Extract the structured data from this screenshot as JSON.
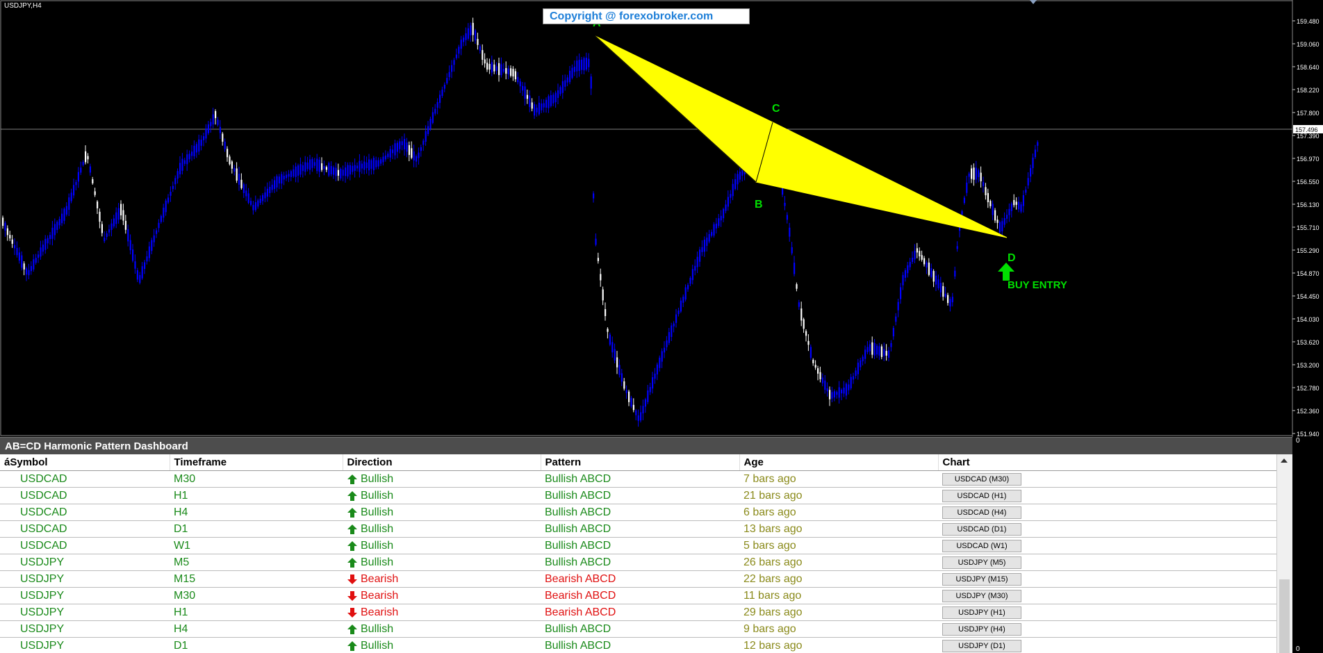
{
  "chart": {
    "symbol_tf": "USDJPY,H4",
    "copyright": "Copyright @ forexobroker.com",
    "current_price": "157.496",
    "price_levels": [
      "159.480",
      "159.060",
      "158.640",
      "158.220",
      "157.800",
      "157.390",
      "156.970",
      "156.550",
      "156.130",
      "155.710",
      "155.290",
      "154.870",
      "154.450",
      "154.030",
      "153.620",
      "153.200",
      "152.780",
      "152.360",
      "151.940"
    ],
    "points": {
      "A": "A",
      "B": "B",
      "C": "C",
      "D": "D"
    },
    "entry_label": "BUY ENTRY",
    "colors": {
      "bull": "#0000ff",
      "bear": "#ffffff",
      "pattern": "#ffff00",
      "label": "#00e000",
      "bg": "#000000"
    }
  },
  "indicator": {
    "zero_top": "0",
    "zero_bottom": "0"
  },
  "dashboard": {
    "title": "AB=CD Harmonic Pattern Dashboard",
    "columns": [
      "áSymbol",
      "Timeframe",
      "Direction",
      "Pattern",
      "Age",
      "Chart"
    ],
    "rows": [
      {
        "symbol": "USDCAD",
        "tf": "M30",
        "dir": "Bullish",
        "pattern": "Bullish ABCD",
        "age": "7 bars ago",
        "chart": "USDCAD (M30)"
      },
      {
        "symbol": "USDCAD",
        "tf": "H1",
        "dir": "Bullish",
        "pattern": "Bullish ABCD",
        "age": "21 bars ago",
        "chart": "USDCAD (H1)"
      },
      {
        "symbol": "USDCAD",
        "tf": "H4",
        "dir": "Bullish",
        "pattern": "Bullish ABCD",
        "age": "6 bars ago",
        "chart": "USDCAD (H4)"
      },
      {
        "symbol": "USDCAD",
        "tf": "D1",
        "dir": "Bullish",
        "pattern": "Bullish ABCD",
        "age": "13 bars ago",
        "chart": "USDCAD (D1)"
      },
      {
        "symbol": "USDCAD",
        "tf": "W1",
        "dir": "Bullish",
        "pattern": "Bullish ABCD",
        "age": "5 bars ago",
        "chart": "USDCAD (W1)"
      },
      {
        "symbol": "USDJPY",
        "tf": "M5",
        "dir": "Bullish",
        "pattern": "Bullish ABCD",
        "age": "26 bars ago",
        "chart": "USDJPY (M5)"
      },
      {
        "symbol": "USDJPY",
        "tf": "M15",
        "dir": "Bearish",
        "pattern": "Bearish ABCD",
        "age": "22 bars ago",
        "chart": "USDJPY (M15)"
      },
      {
        "symbol": "USDJPY",
        "tf": "M30",
        "dir": "Bearish",
        "pattern": "Bearish ABCD",
        "age": "11 bars ago",
        "chart": "USDJPY (M30)"
      },
      {
        "symbol": "USDJPY",
        "tf": "H1",
        "dir": "Bearish",
        "pattern": "Bearish ABCD",
        "age": "29 bars ago",
        "chart": "USDJPY (H1)"
      },
      {
        "symbol": "USDJPY",
        "tf": "H4",
        "dir": "Bullish",
        "pattern": "Bullish ABCD",
        "age": "9 bars ago",
        "chart": "USDJPY (H4)"
      },
      {
        "symbol": "USDJPY",
        "tf": "D1",
        "dir": "Bullish",
        "pattern": "Bullish ABCD",
        "age": "12 bars ago",
        "chart": "USDJPY (D1)"
      }
    ]
  }
}
